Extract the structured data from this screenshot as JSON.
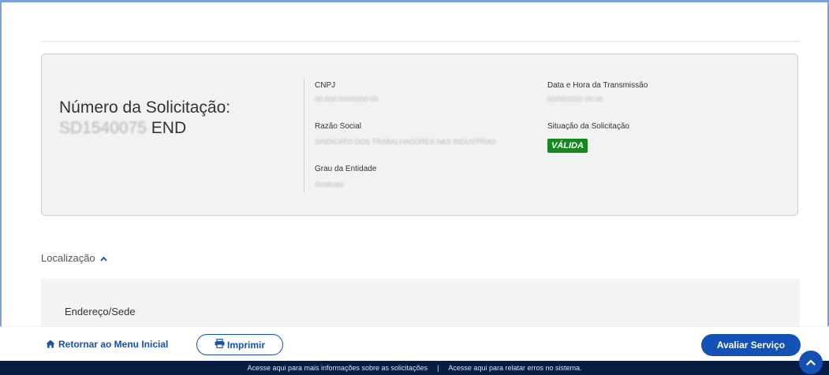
{
  "request": {
    "label": "Número da Solicitação:",
    "number_masked": "SD1540075",
    "number_suffix": "END"
  },
  "fields": {
    "cnpj_label": "CNPJ",
    "cnpj_value": "00.000.000/0000-00",
    "razao_label": "Razão Social",
    "razao_value": "SINDICATO DOS TRABALHADORES NAS INDUSTRIAS",
    "grau_label": "Grau da Entidade",
    "grau_value": "Sindicato",
    "data_label": "Data e Hora da Transmissão",
    "data_value": "00/00/2020 00:00",
    "situacao_label": "Situação da Solicitação",
    "situacao_value": "VÁLIDA"
  },
  "location": {
    "label": "Localização",
    "address_title": "Endereço/Sede"
  },
  "footer": {
    "back_label": "Retornar ao Menu Inicial",
    "print_label": "Imprimir",
    "rate_label": "Avaliar Serviço",
    "info_link": "Acesse aqui para mais informações sobre as solicitações",
    "separator": "|",
    "errors_link": "Acesse aqui para relatar erros no sistema."
  },
  "colors": {
    "primary": "#1351b4",
    "valid_badge": "#168821",
    "footer_strip": "#071d41"
  }
}
